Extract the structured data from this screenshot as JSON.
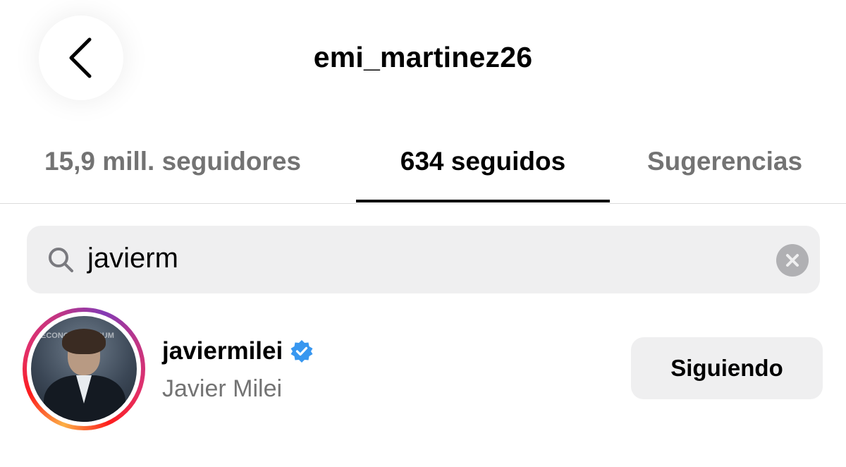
{
  "header": {
    "title": "emi_martinez26",
    "back_icon": "chevron-left-icon"
  },
  "tabs": [
    {
      "label": "15,9 mill. seguidores",
      "active": false
    },
    {
      "label": "634 seguidos",
      "active": true
    },
    {
      "label": "Sugerencias",
      "active": false
    }
  ],
  "search": {
    "value": "javierm",
    "search_icon": "search-icon",
    "clear_icon": "clear-icon"
  },
  "results": [
    {
      "username": "javiermilei",
      "full_name": "Javier Milei",
      "verified": true,
      "button_label": "Siguiendo",
      "avatar_logo_text": "ECONOMIC FORUM"
    }
  ],
  "colors": {
    "secondary_text": "#737373",
    "field_background": "#efeff0",
    "verified_badge": "#3897f0",
    "story_ring": [
      "#fcaf45",
      "#fd1d1d",
      "#e1306c",
      "#c13584",
      "#833ab4"
    ]
  }
}
